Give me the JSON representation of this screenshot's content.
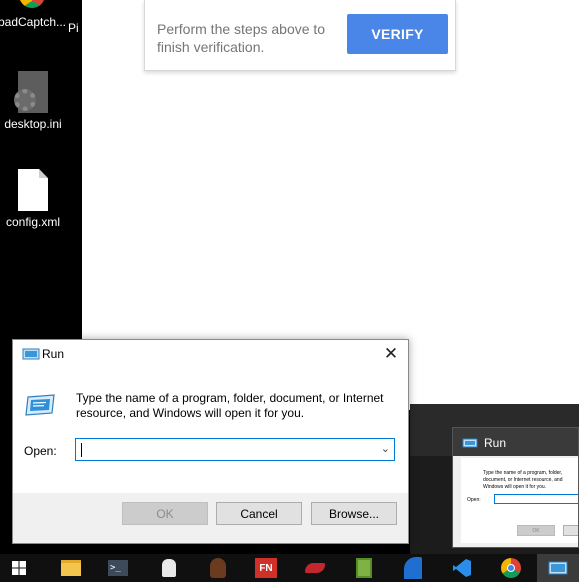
{
  "desktop": {
    "icons": [
      {
        "label": "badCaptch...",
        "name": "badcaptcha-shortcut"
      },
      {
        "label": "Pi",
        "name": "partial-icon"
      },
      {
        "label": "desktop.ini",
        "name": "desktop-ini-file"
      },
      {
        "label": "config.xml",
        "name": "config-xml-file"
      }
    ]
  },
  "captcha": {
    "instruction": "Perform the steps above to finish verification.",
    "verify_label": "VERIFY",
    "accent": "#4a86e8"
  },
  "run_dialog": {
    "title": "Run",
    "close_glyph": "✕",
    "description": "Type the name of a program, folder, document, or Internet resource, and Windows will open it for you.",
    "open_label": "Open:",
    "open_value": "",
    "ok_label": "OK",
    "cancel_label": "Cancel",
    "browse_label": "Browse..."
  },
  "preview": {
    "title": "Run",
    "description": "Type the name of a program, folder, document, or Internet resource, and Windows will open it for you.",
    "open_label": "Open:",
    "ok_label": "OK"
  },
  "taskbar": {
    "icons": [
      "windows-start-icon",
      "file-explorer-icon",
      "terminal-icon",
      "chef-icon",
      "character-icon",
      "fn-icon",
      "pepper-icon",
      "notepad-icon",
      "blue-app-icon",
      "vscode-icon",
      "chrome-icon",
      "run-icon"
    ],
    "fn_text": "FN"
  }
}
